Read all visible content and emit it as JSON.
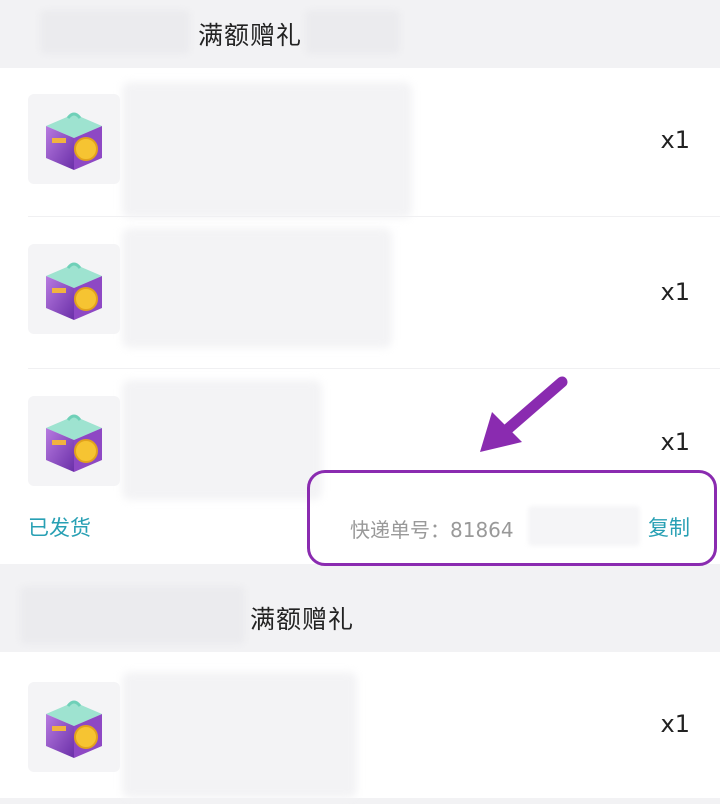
{
  "sections": [
    {
      "title": "满额赠礼"
    },
    {
      "title": "满额赠礼"
    }
  ],
  "items": [
    {
      "qty": "x1",
      "icon": "gift-box-icon"
    },
    {
      "qty": "x1",
      "icon": "gift-box-icon"
    },
    {
      "qty": "x1",
      "icon": "gift-box-icon"
    },
    {
      "qty": "x1",
      "icon": "gift-box-icon"
    }
  ],
  "shipment": {
    "status": "已发货",
    "tracking_label": "快递单号：",
    "tracking_number_visible": "81864",
    "copy_label": "复制"
  },
  "colors": {
    "accent": "#28a0b4",
    "highlight": "#8a2bb0"
  }
}
